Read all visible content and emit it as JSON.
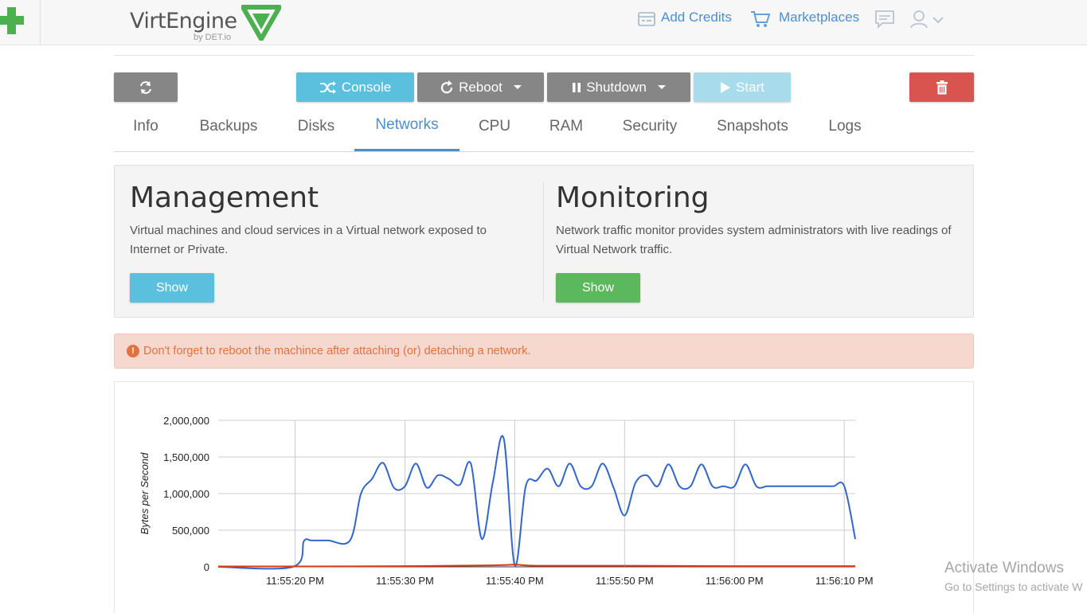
{
  "header": {
    "logo_text": "VirtEngine",
    "logo_sub": "by DET.io",
    "add_credits": "Add Credits",
    "marketplaces": "Marketplaces"
  },
  "actions": {
    "console": "Console",
    "reboot": "Reboot",
    "shutdown": "Shutdown",
    "start": "Start"
  },
  "tabs": [
    {
      "label": "Info"
    },
    {
      "label": "Backups"
    },
    {
      "label": "Disks"
    },
    {
      "label": "Networks",
      "active": true
    },
    {
      "label": "CPU"
    },
    {
      "label": "RAM"
    },
    {
      "label": "Security"
    },
    {
      "label": "Snapshots"
    },
    {
      "label": "Logs"
    }
  ],
  "management": {
    "title": "Management",
    "description": "Virtual machines and cloud services in a Virtual network exposed to Internet or Private.",
    "button": "Show"
  },
  "monitoring": {
    "title": "Monitoring",
    "description": "Network traffic monitor provides system administrators with live readings of Virtual Network traffic.",
    "button": "Show"
  },
  "alert": {
    "text": "Don't forget to reboot the machince after attaching (or) detaching a network."
  },
  "colors": {
    "accent": "#4b8fd3",
    "series_in": "#3366cc",
    "series_out": "#dc3912",
    "alert_text": "#e0733f"
  },
  "chart_data": {
    "type": "line",
    "title": "",
    "xlabel": "",
    "ylabel": "Bytes per Second",
    "ylim": [
      0,
      2000000
    ],
    "y_ticks": [
      "2,000,000",
      "1,500,000",
      "1,000,000",
      "500,000",
      "0"
    ],
    "y_tick_values": [
      2000000,
      1500000,
      1000000,
      500000,
      0
    ],
    "x_ticks": [
      "11:55:20 PM",
      "11:55:30 PM",
      "11:55:40 PM",
      "11:55:50 PM",
      "11:56:00 PM",
      "11:56:10 PM"
    ],
    "x_tick_values": [
      20,
      30,
      40,
      50,
      60,
      70
    ],
    "xlim": [
      13,
      71
    ],
    "grid": true,
    "series": [
      {
        "color": "#3366cc",
        "x": [
          13,
          19.8,
          20.8,
          21.5,
          23,
          25,
          26,
          27,
          28,
          29,
          30,
          31,
          32,
          33,
          34,
          35,
          36,
          37,
          38,
          39,
          40,
          41,
          42,
          43,
          44,
          45,
          46,
          47,
          48,
          49,
          50,
          51,
          52,
          53,
          54,
          55,
          56,
          57,
          58,
          59,
          60,
          61,
          62,
          63,
          64,
          65,
          66,
          67,
          68,
          69,
          70,
          71
        ],
        "y": [
          0,
          0,
          350000,
          360000,
          360000,
          360000,
          1000000,
          1200000,
          1420000,
          1080000,
          1100000,
          1410000,
          1080000,
          1250000,
          1200000,
          1120000,
          1410000,
          380000,
          1150000,
          1750000,
          20000,
          1100000,
          1180000,
          1340000,
          1100000,
          1410000,
          1100000,
          1100000,
          1410000,
          1080000,
          700000,
          1150000,
          1250000,
          1100000,
          1400000,
          1100000,
          1100000,
          1400000,
          1100000,
          1100000,
          1100000,
          1400000,
          1100000,
          1100000,
          1100000,
          1100000,
          1100000,
          1100000,
          1100000,
          1100000,
          1100000,
          380000
        ]
      },
      {
        "color": "#dc3912",
        "x": [
          13,
          20,
          30,
          38,
          40,
          42,
          50,
          60,
          71
        ],
        "y": [
          5000,
          5000,
          10000,
          20000,
          30000,
          15000,
          15000,
          10000,
          10000
        ]
      }
    ]
  },
  "watermark": {
    "title": "Activate Windows",
    "subtitle": "Go to Settings to activate W"
  }
}
